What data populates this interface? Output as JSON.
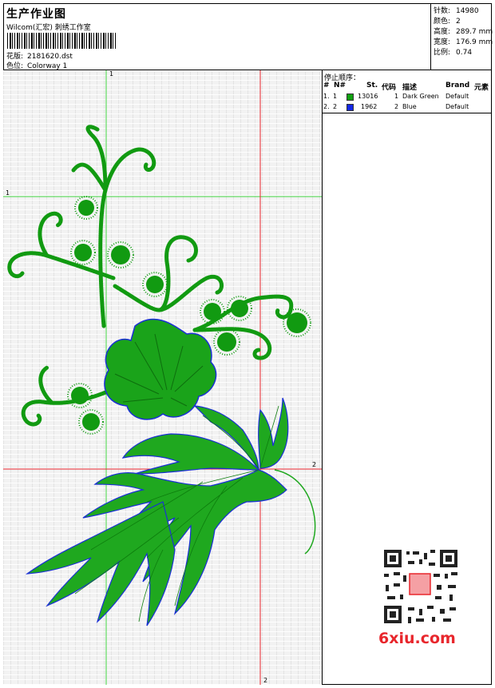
{
  "header": {
    "title": "生产作业图",
    "subtitle": "Wilcom(汇宏) 刺绣工作室",
    "pattern_label": "花版:",
    "pattern_value": "2181620.dst",
    "colorway_label": "色位:",
    "colorway_value": "Colorway 1"
  },
  "stats": [
    {
      "label": "针数:",
      "value": "14980"
    },
    {
      "label": "颜色:",
      "value": "2"
    },
    {
      "label": "高度:",
      "value": "289.7 mm"
    },
    {
      "label": "宽度:",
      "value": "176.9 mm"
    },
    {
      "label": "比例:",
      "value": "0.74"
    }
  ],
  "design": {
    "markers": {
      "v1": "1",
      "h1": "1",
      "h2": "2",
      "v2": "2"
    },
    "colors": {
      "green": "#119a11",
      "blue": "#1a2fd6",
      "guide_green": "#44d644",
      "guide_red": "#e8242c"
    }
  },
  "stop_sequence": {
    "title": "停止顺序：",
    "headers": [
      "#",
      "N#",
      "St.",
      "代码",
      "描述",
      "Brand",
      "元素"
    ],
    "rows": [
      {
        "num": "1.",
        "n": "1",
        "color": "#11a011",
        "stitches": "13016",
        "code": "1",
        "desc": "Dark Green",
        "brand": "Default"
      },
      {
        "num": "2.",
        "n": "2",
        "color": "#1428e6",
        "stitches": "1962",
        "code": "2",
        "desc": "Blue",
        "brand": "Default"
      }
    ]
  },
  "logo": {
    "text": "6xiu.com",
    "seal": "刺绣图库"
  }
}
